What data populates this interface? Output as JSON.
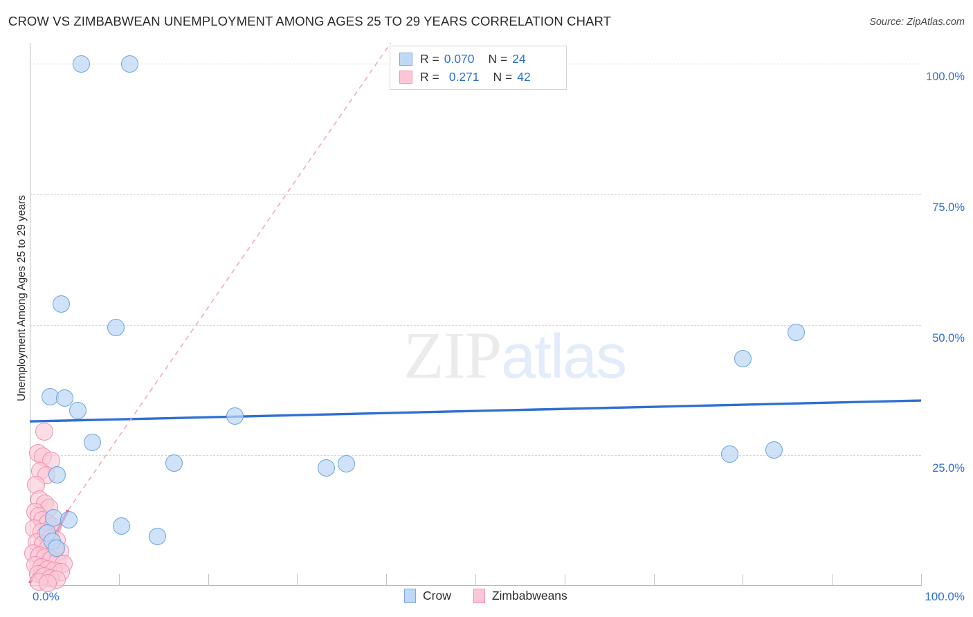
{
  "title": "CROW VS ZIMBABWEAN UNEMPLOYMENT AMONG AGES 25 TO 29 YEARS CORRELATION CHART",
  "source": "Source: ZipAtlas.com",
  "watermark": {
    "part1": "ZIP",
    "part2": "atlas"
  },
  "axes": {
    "y_title": "Unemployment Among Ages 25 to 29 years",
    "y_ticks": [
      "100.0%",
      "75.0%",
      "50.0%",
      "25.0%"
    ],
    "x_min_label": "0.0%",
    "x_max_label": "100.0%"
  },
  "stat_legend": {
    "rows": [
      {
        "series": "Crow",
        "r_label": "R =",
        "r_value": "0.070",
        "n_label": "N =",
        "n_value": "24"
      },
      {
        "series": "Zimbabweans",
        "r_label": "R =",
        "r_value": "0.271",
        "n_label": "N =",
        "n_value": "42"
      }
    ]
  },
  "series_legend": [
    {
      "name": "Crow",
      "color": "#bfd8f5"
    },
    {
      "name": "Zimbabweans",
      "color": "#fbc6d5"
    }
  ],
  "colors": {
    "crow_fill": "#bfd8f5",
    "crow_stroke": "#6aa3e0",
    "zim_fill": "#fbc6d5",
    "zim_stroke": "#f090ad",
    "crow_trend": "#2f6fd0",
    "zim_trend": "#e0527c",
    "tick_text": "#2f6fd0",
    "grid": "#d8d8d8"
  },
  "chart_data": {
    "type": "scatter",
    "title": "CROW VS ZIMBABWEAN UNEMPLOYMENT AMONG AGES 25 TO 29 YEARS CORRELATION CHART",
    "xlabel": "",
    "ylabel": "Unemployment Among Ages 25 to 29 years",
    "xlim": [
      0,
      100
    ],
    "ylim": [
      0,
      104
    ],
    "x_ticks": [
      0,
      10,
      20,
      30,
      40,
      50,
      60,
      70,
      80,
      90,
      100
    ],
    "y_ticks": [
      25,
      50,
      75,
      100
    ],
    "grid": true,
    "legend_position": "bottom-center",
    "series": [
      {
        "name": "Crow",
        "color": "#bfd8f5",
        "r": 0.07,
        "n": 24,
        "trendline": {
          "style": "solid",
          "x0": 0,
          "y0": 31.5,
          "x1": 100,
          "y1": 35.5
        },
        "points": [
          [
            5.8,
            100.0
          ],
          [
            11.2,
            100.0
          ],
          [
            3.5,
            54.0
          ],
          [
            9.7,
            49.5
          ],
          [
            86.0,
            48.5
          ],
          [
            80.0,
            43.5
          ],
          [
            2.3,
            36.3
          ],
          [
            3.9,
            36.0
          ],
          [
            5.4,
            33.6
          ],
          [
            23.0,
            32.5
          ],
          [
            7.0,
            27.5
          ],
          [
            83.5,
            26.0
          ],
          [
            78.5,
            25.2
          ],
          [
            16.2,
            23.5
          ],
          [
            35.5,
            23.4
          ],
          [
            33.3,
            22.6
          ],
          [
            3.1,
            21.2
          ],
          [
            2.7,
            13.0
          ],
          [
            4.4,
            12.6
          ],
          [
            10.3,
            11.5
          ],
          [
            14.3,
            9.5
          ],
          [
            2.0,
            10.2
          ],
          [
            2.5,
            8.5
          ],
          [
            3.0,
            7.2
          ]
        ]
      },
      {
        "name": "Zimbabweans",
        "color": "#fbc6d5",
        "r": 0.271,
        "n": 42,
        "trendline": {
          "style": "solid-then-dashed",
          "x0": 0,
          "y0": 0.5,
          "x_solid_end": 4.3,
          "y_solid_end": 14.5,
          "x1": 40.5,
          "y1": 104
        },
        "points": [
          [
            1.6,
            29.6
          ],
          [
            0.9,
            25.5
          ],
          [
            1.5,
            24.8
          ],
          [
            2.4,
            24.0
          ],
          [
            1.2,
            22.0
          ],
          [
            1.9,
            21.2
          ],
          [
            0.7,
            19.3
          ],
          [
            1.1,
            16.5
          ],
          [
            1.7,
            15.7
          ],
          [
            2.2,
            15.0
          ],
          [
            0.6,
            14.2
          ],
          [
            1.0,
            13.4
          ],
          [
            1.4,
            12.6
          ],
          [
            2.0,
            12.0
          ],
          [
            2.6,
            11.4
          ],
          [
            0.5,
            11.0
          ],
          [
            1.3,
            10.4
          ],
          [
            1.8,
            9.8
          ],
          [
            2.3,
            9.2
          ],
          [
            3.0,
            8.8
          ],
          [
            0.8,
            8.4
          ],
          [
            1.5,
            7.9
          ],
          [
            2.1,
            7.4
          ],
          [
            2.8,
            7.0
          ],
          [
            3.4,
            6.6
          ],
          [
            0.4,
            6.2
          ],
          [
            1.1,
            5.8
          ],
          [
            1.7,
            5.4
          ],
          [
            2.4,
            5.0
          ],
          [
            3.1,
            4.6
          ],
          [
            3.8,
            4.3
          ],
          [
            0.6,
            4.0
          ],
          [
            1.3,
            3.6
          ],
          [
            2.0,
            3.2
          ],
          [
            2.7,
            2.9
          ],
          [
            3.5,
            2.6
          ],
          [
            0.9,
            2.2
          ],
          [
            1.6,
            1.9
          ],
          [
            2.3,
            1.5
          ],
          [
            3.0,
            1.2
          ],
          [
            1.0,
            0.8
          ],
          [
            2.0,
            0.5
          ]
        ]
      }
    ]
  }
}
